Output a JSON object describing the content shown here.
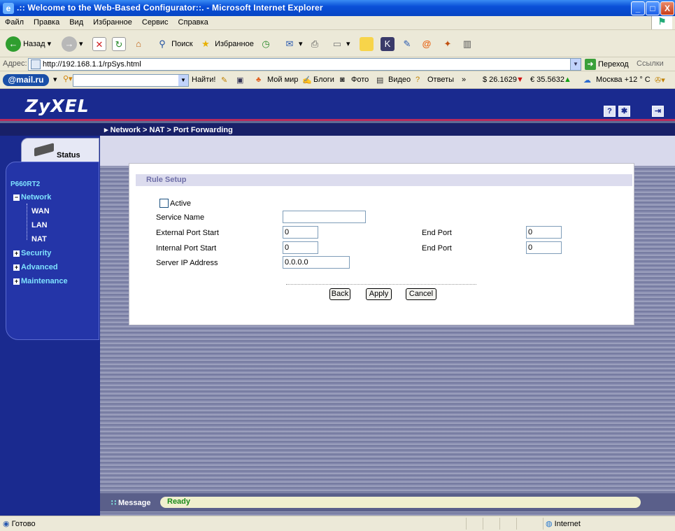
{
  "window": {
    "title": ".:: Welcome to the Web-Based Configurator::. - Microsoft Internet Explorer",
    "minimize": "_",
    "maximize": "□",
    "close": "X"
  },
  "menu": [
    "Файл",
    "Правка",
    "Вид",
    "Избранное",
    "Сервис",
    "Справка"
  ],
  "toolbar": {
    "back": "Назад",
    "search": "Поиск",
    "favorites": "Избранное"
  },
  "address": {
    "label": "Адрес:",
    "url": "http://192.168.1.1/rpSys.html",
    "go": "Переход",
    "links": "Ссылки"
  },
  "mailru": {
    "logo": "@mail.ru",
    "find": "Найти!",
    "moi_mir": "Мой мир",
    "blogs": "Блоги",
    "photo": "Фото",
    "video": "Видео",
    "answers": "Ответы",
    "usd": "$ 26.1629",
    "eur": "€ 35.5632",
    "weather": "Москва +12 ° C"
  },
  "router": {
    "brand": "ZyXEL",
    "breadcrumb": "Network > NAT > Port Forwarding",
    "status_tab": "Status",
    "model": "P660RT2",
    "nav": {
      "network": "Network",
      "wan": "WAN",
      "lan": "LAN",
      "nat": "NAT",
      "security": "Security",
      "advanced": "Advanced",
      "maintenance": "Maintenance"
    }
  },
  "form": {
    "section_title": "Rule Setup",
    "active_label": "Active",
    "service_name_label": "Service Name",
    "service_name_value": "",
    "ext_start_label": "External Port Start",
    "ext_start_value": "0",
    "ext_end_label": "End Port",
    "ext_end_value": "0",
    "int_start_label": "Internal Port Start",
    "int_start_value": "0",
    "int_end_label": "End Port",
    "int_end_value": "0",
    "server_ip_label": "Server IP Address",
    "server_ip_value": "0.0.0.0",
    "back": "Back",
    "apply": "Apply",
    "cancel": "Cancel"
  },
  "message": {
    "label": "Message",
    "text": "Ready"
  },
  "statusbar": {
    "status": "Готово",
    "zone": "Internet"
  }
}
